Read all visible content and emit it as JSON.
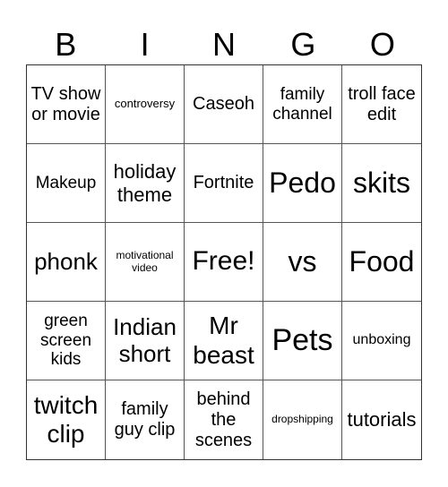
{
  "header": [
    "B",
    "I",
    "N",
    "G",
    "O"
  ],
  "cells": [
    {
      "text": "TV show or movie",
      "size": 20
    },
    {
      "text": "controversy",
      "size": 13
    },
    {
      "text": "Caseoh",
      "size": 20
    },
    {
      "text": "family channel",
      "size": 19
    },
    {
      "text": "troll face edit",
      "size": 20
    },
    {
      "text": "Makeup",
      "size": 19
    },
    {
      "text": "holiday theme",
      "size": 22
    },
    {
      "text": "Fortnite",
      "size": 20
    },
    {
      "text": "Pedo",
      "size": 32
    },
    {
      "text": "skits",
      "size": 32
    },
    {
      "text": "phonk",
      "size": 26
    },
    {
      "text": "motivational video",
      "size": 12
    },
    {
      "text": "Free!",
      "size": 30
    },
    {
      "text": "vs",
      "size": 32
    },
    {
      "text": "Food",
      "size": 32
    },
    {
      "text": "green screen kids",
      "size": 19
    },
    {
      "text": "Indian short",
      "size": 26
    },
    {
      "text": "Mr beast",
      "size": 28
    },
    {
      "text": "Pets",
      "size": 34
    },
    {
      "text": "unboxing",
      "size": 16
    },
    {
      "text": "twitch clip",
      "size": 28
    },
    {
      "text": "family guy clip",
      "size": 20
    },
    {
      "text": "behind the scenes",
      "size": 20
    },
    {
      "text": "dropshipping",
      "size": 12
    },
    {
      "text": "tutorials",
      "size": 22
    }
  ]
}
